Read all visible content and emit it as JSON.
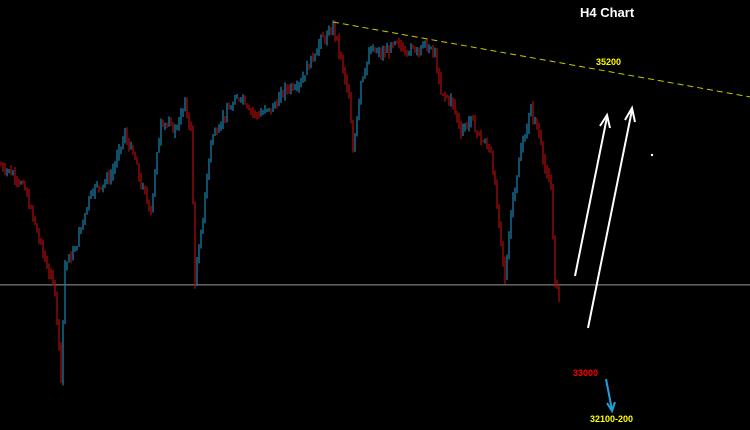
{
  "chart_data": {
    "type": "candlestick",
    "title": "H4 Chart",
    "x_unit": "bar index",
    "price_range": [
      32100,
      35500
    ],
    "path_keypoints": [
      [
        0,
        34476
      ],
      [
        7,
        34405
      ],
      [
        12,
        34299
      ],
      [
        22,
        33802
      ],
      [
        27,
        33589
      ],
      [
        30,
        32986
      ],
      [
        32,
        33766
      ],
      [
        37,
        33873
      ],
      [
        45,
        34299
      ],
      [
        50,
        34334
      ],
      [
        55,
        34405
      ],
      [
        62,
        34689
      ],
      [
        67,
        34512
      ],
      [
        70,
        34334
      ],
      [
        75,
        34157
      ],
      [
        80,
        34796
      ],
      [
        87,
        34725
      ],
      [
        92,
        34902
      ],
      [
        95,
        34725
      ],
      [
        97,
        33660
      ],
      [
        100,
        33979
      ],
      [
        105,
        34654
      ],
      [
        110,
        34796
      ],
      [
        120,
        34973
      ],
      [
        127,
        34831
      ],
      [
        135,
        34867
      ],
      [
        142,
        35008
      ],
      [
        150,
        35079
      ],
      [
        155,
        35221
      ],
      [
        160,
        35363
      ],
      [
        164,
        35398
      ],
      [
        166,
        35470
      ],
      [
        170,
        35221
      ],
      [
        174,
        34938
      ],
      [
        176,
        34583
      ],
      [
        180,
        35079
      ],
      [
        185,
        35292
      ],
      [
        190,
        35257
      ],
      [
        197,
        35328
      ],
      [
        205,
        35292
      ],
      [
        212,
        35328
      ],
      [
        217,
        35257
      ],
      [
        220,
        34973
      ],
      [
        225,
        34938
      ],
      [
        230,
        34725
      ],
      [
        235,
        34796
      ],
      [
        240,
        34654
      ],
      [
        245,
        34583
      ],
      [
        250,
        33908
      ],
      [
        252,
        33660
      ],
      [
        255,
        34157
      ],
      [
        260,
        34583
      ],
      [
        265,
        34867
      ],
      [
        270,
        34654
      ],
      [
        272,
        34441
      ],
      [
        275,
        34299
      ],
      [
        277,
        33660
      ],
      [
        279,
        33518
      ]
    ],
    "bull_color": "#1a7aa3",
    "bear_color": "#a00d0d",
    "support_level": 33625,
    "trendline": {
      "from": [
        166,
        35491
      ],
      "to": [
        375,
        34958
      ],
      "color": "#c8c800"
    },
    "annotations": [
      {
        "text": "35200",
        "color": "#ffff00"
      },
      {
        "text": "33000",
        "color": "#ff0000"
      },
      {
        "text": "32100-200",
        "color": "#ffff00"
      }
    ]
  }
}
